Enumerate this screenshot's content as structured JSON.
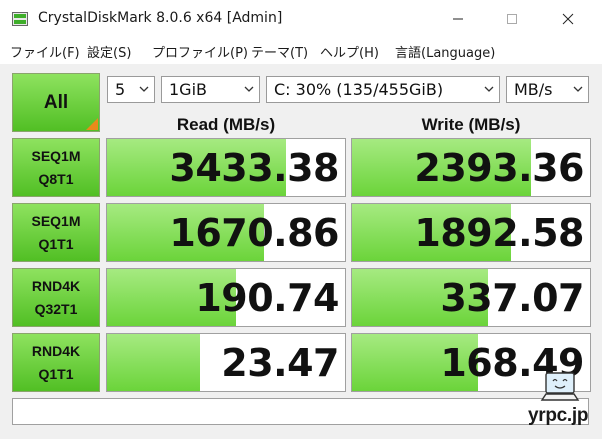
{
  "window": {
    "title": "CrystalDiskMark 8.0.6 x64 [Admin]"
  },
  "menu": [
    "ファイル(F)",
    "設定(S)",
    "プロファイル(P)",
    "テーマ(T)",
    "ヘルプ(H)",
    "言語(Language)"
  ],
  "controls": {
    "all_label": "All",
    "count": "5",
    "size": "1GiB",
    "drive": "C: 30% (135/455GiB)",
    "unit": "MB/s"
  },
  "headers": {
    "read": "Read (MB/s)",
    "write": "Write (MB/s)"
  },
  "tests": [
    {
      "line1": "SEQ1M",
      "line2": "Q8T1",
      "read": "3433.38",
      "write": "2393.36",
      "read_fill": 0.75,
      "write_fill": 0.75
    },
    {
      "line1": "SEQ1M",
      "line2": "Q1T1",
      "read": "1670.86",
      "write": "1892.58",
      "read_fill": 0.66,
      "write_fill": 0.67
    },
    {
      "line1": "RND4K",
      "line2": "Q32T1",
      "read": "190.74",
      "write": "337.07",
      "read_fill": 0.54,
      "write_fill": 0.57
    },
    {
      "line1": "RND4K",
      "line2": "Q1T1",
      "read": "23.47",
      "write": "168.49",
      "read_fill": 0.39,
      "write_fill": 0.53
    }
  ],
  "status_text": "",
  "watermark": "yrpc.jp",
  "colors": {
    "button_green": "#51bf24",
    "bar_green": "#6bd43a",
    "corner_orange": "#e98a1b"
  }
}
